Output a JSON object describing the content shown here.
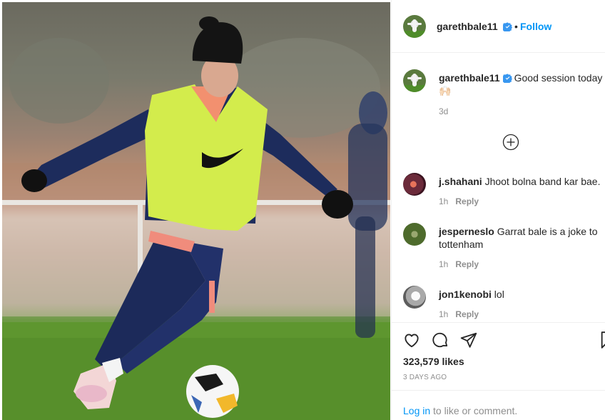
{
  "post": {
    "author": "garethbale11",
    "follow_label": "Follow",
    "separator": "•"
  },
  "caption": {
    "username": "garethbale11",
    "text": "Good session today",
    "emoji": "🙌🏻",
    "time": "3d"
  },
  "comments": [
    {
      "username": "j.shahani",
      "text": "Jhoot bolna band kar bae.",
      "time": "1h",
      "reply_label": "Reply"
    },
    {
      "username": "jesperneslo",
      "text": "Garrat bale is a joke to tottenham",
      "time": "1h",
      "reply_label": "Reply"
    },
    {
      "username": "jon1kenobi",
      "text": "lol",
      "time": "1h",
      "reply_label": "Reply"
    }
  ],
  "actions": {
    "likes": "323,579 likes",
    "posted": "3 DAYS AGO",
    "icons": [
      "heart-icon",
      "comment-icon",
      "share-icon",
      "bookmark-icon"
    ]
  },
  "login_prompt": {
    "link": "Log in",
    "rest": " to like or comment."
  },
  "colors": {
    "link_blue": "#0095f6",
    "verified_blue": "#3897f0",
    "muted_gray": "#8e8e8e"
  }
}
